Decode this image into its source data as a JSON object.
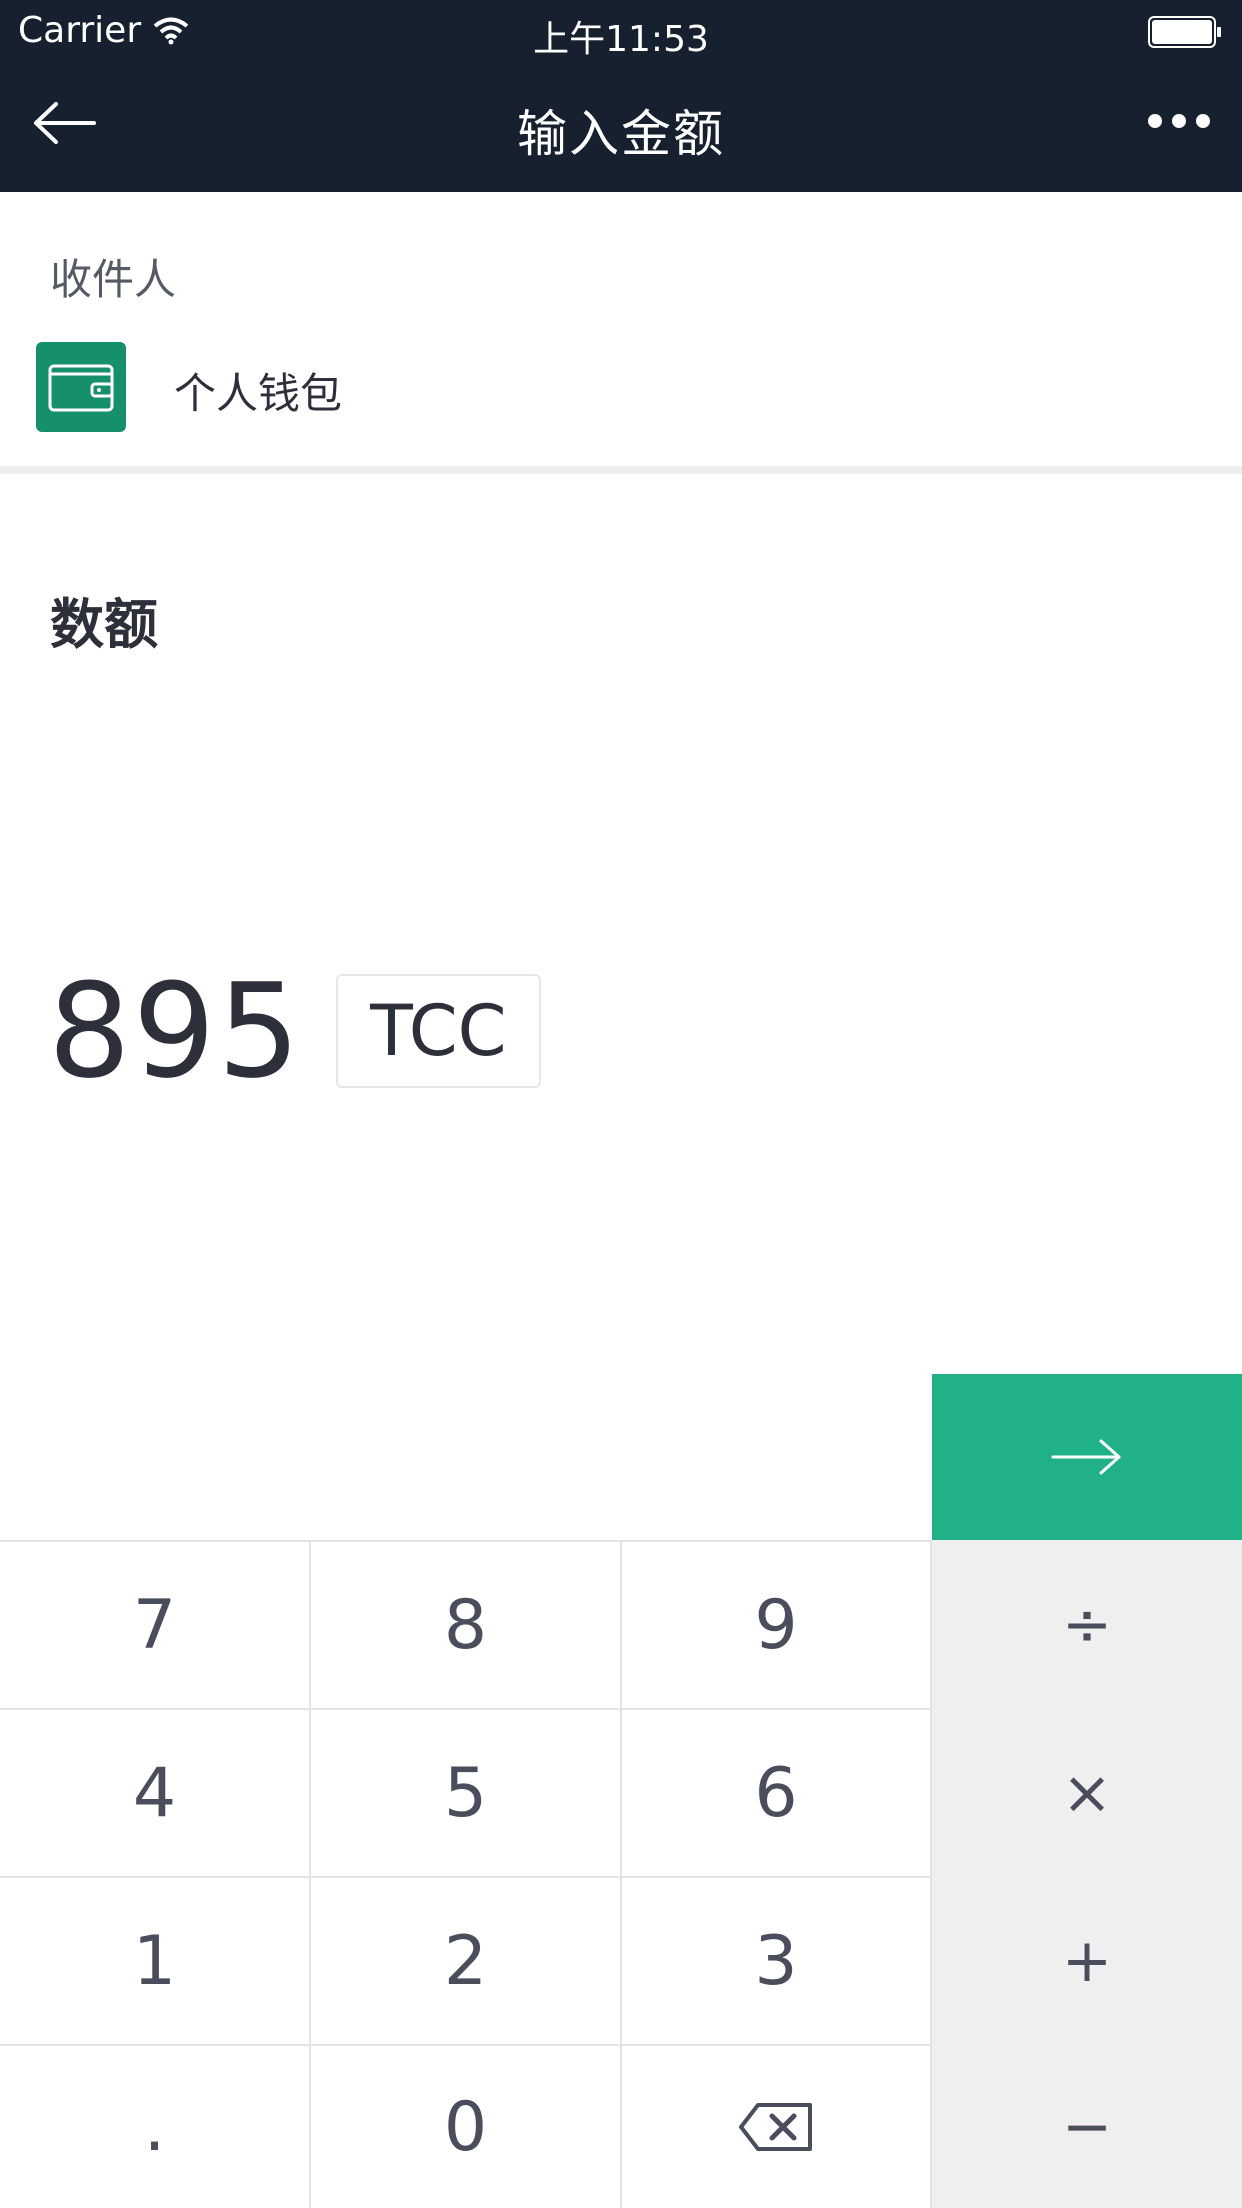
{
  "status_bar": {
    "carrier": "Carrier",
    "time": "上午11:53"
  },
  "nav": {
    "title": "输入金额",
    "back_icon": "arrow-left-icon",
    "more_icon": "more-dots-icon"
  },
  "recipient": {
    "label": "收件人",
    "wallet_name": "个人钱包",
    "wallet_icon": "wallet-icon"
  },
  "amount": {
    "label": "数额",
    "value": "895",
    "currency": "TCC"
  },
  "submit": {
    "icon": "arrow-right-icon"
  },
  "keypad": {
    "keys": [
      "7",
      "8",
      "9",
      "4",
      "5",
      "6",
      "1",
      "2",
      "3",
      ".",
      "0"
    ],
    "backspace_icon": "backspace-icon",
    "operators": [
      "÷",
      "×",
      "+",
      "−"
    ]
  },
  "colors": {
    "nav_bg": "#17202e",
    "accent": "#20b189",
    "wallet": "#168f6c"
  }
}
